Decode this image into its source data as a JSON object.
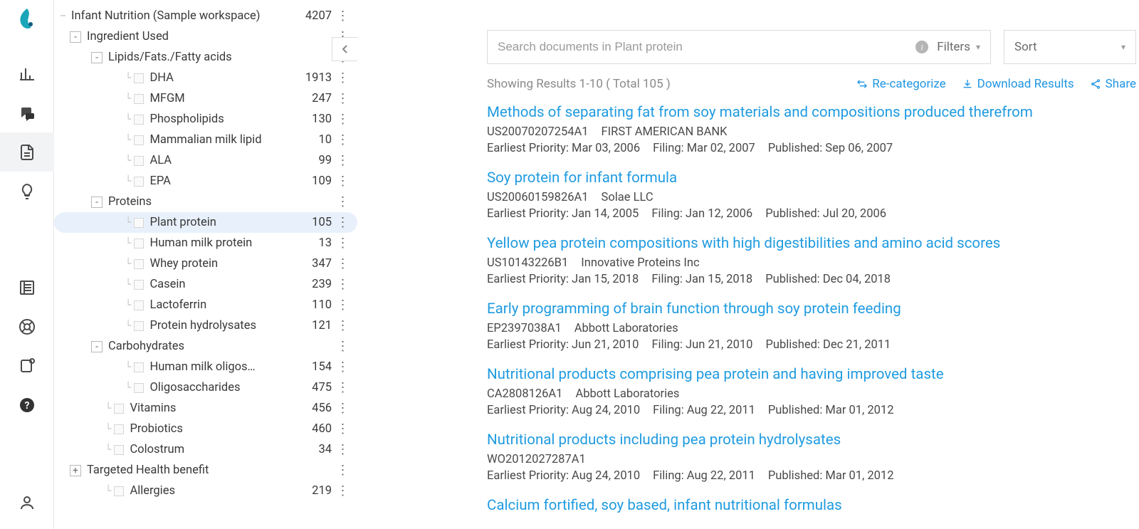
{
  "rail": {
    "items": [
      "logo",
      "charts",
      "chat",
      "documents",
      "lightbulb",
      "book",
      "lifebuoy",
      "notification",
      "help",
      "user"
    ],
    "active_index": 3
  },
  "tree": {
    "root": {
      "label": "Infant Nutrition (Sample workspace)",
      "count": 4207
    },
    "nodes": [
      {
        "indent": 0,
        "kind": "root",
        "label": "Infant Nutrition (Sample workspace)",
        "count": 4207
      },
      {
        "indent": 1,
        "kind": "branch",
        "toggle": "-",
        "label": "Ingredient Used",
        "count": ""
      },
      {
        "indent": 2,
        "kind": "branch",
        "toggle": "-",
        "label": "Lipids/Fats./Fatty acids",
        "count": ""
      },
      {
        "indent": 3,
        "kind": "leaf",
        "label": "DHA",
        "count": 1913
      },
      {
        "indent": 3,
        "kind": "leaf",
        "label": "MFGM",
        "count": 247
      },
      {
        "indent": 3,
        "kind": "leaf",
        "label": "Phospholipids",
        "count": 130
      },
      {
        "indent": 3,
        "kind": "leaf",
        "label": "Mammalian milk lipid",
        "count": 10
      },
      {
        "indent": 3,
        "kind": "leaf",
        "label": "ALA",
        "count": 99
      },
      {
        "indent": 3,
        "kind": "leaf",
        "label": "EPA",
        "count": 109
      },
      {
        "indent": 2,
        "kind": "branch",
        "toggle": "-",
        "label": "Proteins",
        "count": ""
      },
      {
        "indent": 3,
        "kind": "leaf",
        "label": "Plant protein",
        "count": 105,
        "selected": true
      },
      {
        "indent": 3,
        "kind": "leaf",
        "label": "Human milk protein",
        "count": 13
      },
      {
        "indent": 3,
        "kind": "leaf",
        "label": "Whey protein",
        "count": 347
      },
      {
        "indent": 3,
        "kind": "leaf",
        "label": "Casein",
        "count": 239
      },
      {
        "indent": 3,
        "kind": "leaf",
        "label": "Lactoferrin",
        "count": 110
      },
      {
        "indent": 3,
        "kind": "leaf",
        "label": "Protein hydrolysates",
        "count": 121
      },
      {
        "indent": 2,
        "kind": "branch",
        "toggle": "-",
        "label": "Carbohydrates",
        "count": ""
      },
      {
        "indent": 3,
        "kind": "leaf",
        "label": "Human milk oligos…",
        "count": 154
      },
      {
        "indent": 3,
        "kind": "leaf",
        "label": "Oligosaccharides",
        "count": 475
      },
      {
        "indent": 2,
        "kind": "leaf-mid",
        "label": "Vitamins",
        "count": 456
      },
      {
        "indent": 2,
        "kind": "leaf-mid",
        "label": "Probiotics",
        "count": 460
      },
      {
        "indent": 2,
        "kind": "leaf-mid",
        "label": "Colostrum",
        "count": 34
      },
      {
        "indent": 1,
        "kind": "branch",
        "toggle": "+",
        "label": "Targeted Health benefit",
        "count": ""
      },
      {
        "indent": 2,
        "kind": "leaf-mid",
        "label": "Allergies",
        "count": 219
      }
    ]
  },
  "search": {
    "placeholder": "Search documents in Plant protein",
    "filters": "Filters"
  },
  "sort": {
    "label": "Sort"
  },
  "results_bar": {
    "showing": "Showing Results 1-10 ( Total 105 )",
    "actions": {
      "recat": "Re-categorize",
      "download": "Download Results",
      "share": "Share"
    }
  },
  "results": [
    {
      "title": "Methods of separating fat from soy materials and compositions produced therefrom",
      "id": "US20070207254A1",
      "assignee": "FIRST AMERICAN BANK",
      "priority": "Earliest Priority: Mar 03, 2006",
      "filing": "Filing: Mar 02, 2007",
      "published": "Published: Sep 06, 2007"
    },
    {
      "title": "Soy protein for infant formula",
      "id": "US20060159826A1",
      "assignee": "Solae LLC",
      "priority": "Earliest Priority: Jan 14, 2005",
      "filing": "Filing: Jan 12, 2006",
      "published": "Published: Jul 20, 2006"
    },
    {
      "title": "Yellow pea protein compositions with high digestibilities and amino acid scores",
      "id": "US10143226B1",
      "assignee": "Innovative Proteins Inc",
      "priority": "Earliest Priority: Jan 15, 2018",
      "filing": "Filing: Jan 15, 2018",
      "published": "Published: Dec 04, 2018"
    },
    {
      "title": "Early programming of brain function through soy protein feeding",
      "id": "EP2397038A1",
      "assignee": "Abbott Laboratories",
      "priority": "Earliest Priority: Jun 21, 2010",
      "filing": "Filing: Jun 21, 2010",
      "published": "Published: Dec 21, 2011"
    },
    {
      "title": "Nutritional products comprising pea protein and having improved taste",
      "id": "CA2808126A1",
      "assignee": "Abbott Laboratories",
      "priority": "Earliest Priority: Aug 24, 2010",
      "filing": "Filing: Aug 22, 2011",
      "published": "Published: Mar 01, 2012"
    },
    {
      "title": "Nutritional products including pea protein hydrolysates",
      "id": "WO2012027287A1",
      "assignee": "",
      "priority": "Earliest Priority: Aug 24, 2010",
      "filing": "Filing: Aug 22, 2011",
      "published": "Published: Mar 01, 2012"
    },
    {
      "title": "Calcium fortified, soy based, infant nutritional formulas",
      "id": "",
      "assignee": "",
      "priority": "",
      "filing": "",
      "published": ""
    }
  ]
}
